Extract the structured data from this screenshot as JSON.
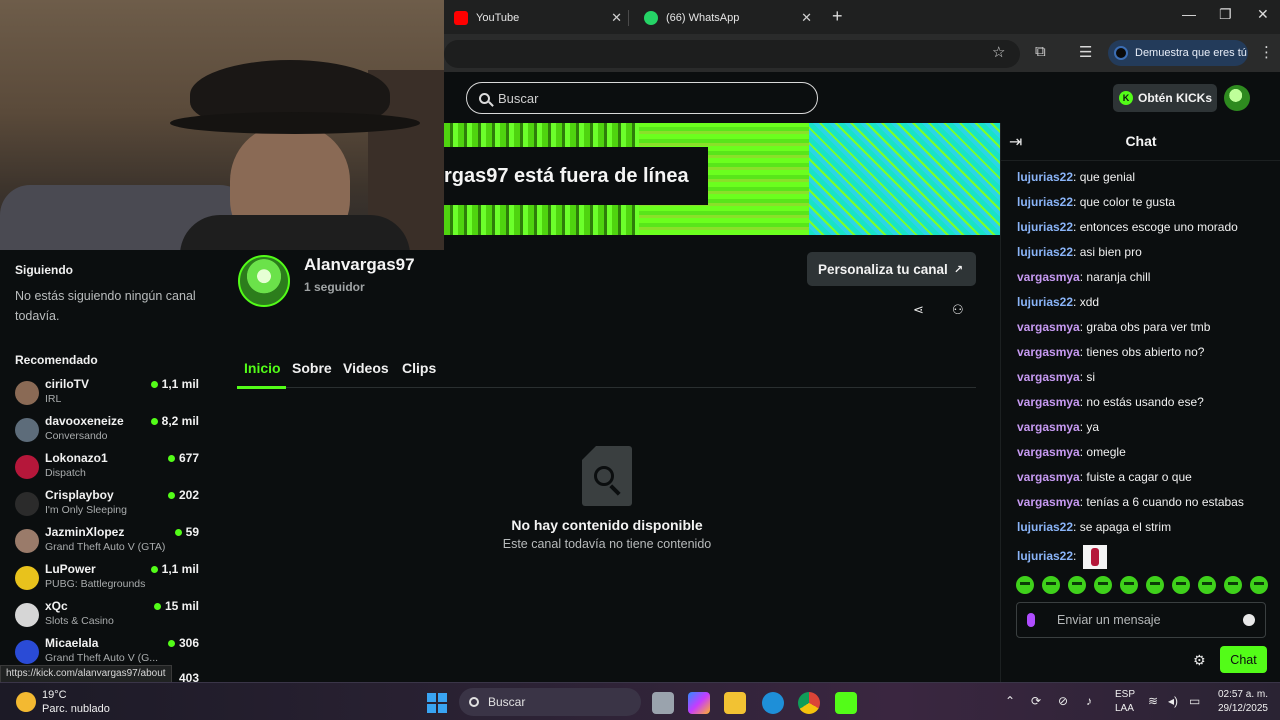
{
  "browser": {
    "tabs": [
      {
        "title": "YouTube",
        "icon": "youtube-icon",
        "color": "#ff0000"
      },
      {
        "title": "(66) WhatsApp",
        "icon": "whatsapp-icon",
        "color": "#25d366"
      }
    ],
    "profile_label": "Demuestra que eres tú"
  },
  "kick": {
    "search_placeholder": "Buscar",
    "kicks_button": "Obtén KICKs",
    "offline_text": "rgas97 está fuera de línea",
    "accent": "#53fc18"
  },
  "sidebar": {
    "following_title": "Siguiendo",
    "following_note": "No estás siguiendo ningún canal todavía.",
    "recommended_title": "Recomendado",
    "recommended": [
      {
        "name": "ciriloTV",
        "category": "IRL",
        "viewers": "1,1 mil",
        "color": "#8a6a55"
      },
      {
        "name": "davooxeneize",
        "category": "Conversando",
        "viewers": "8,2 mil",
        "color": "#5d6c7a"
      },
      {
        "name": "Lokonazo1",
        "category": "Dispatch",
        "viewers": "677",
        "color": "#b5173a"
      },
      {
        "name": "Crisplayboy",
        "category": "I'm Only Sleeping",
        "viewers": "202",
        "color": "#2b2b2b"
      },
      {
        "name": "JazminXlopez",
        "category": "Grand Theft Auto V (GTA)",
        "viewers": "59",
        "color": "#9a7b6a"
      },
      {
        "name": "LuPower",
        "category": "PUBG: Battlegrounds",
        "viewers": "1,1 mil",
        "color": "#e8c21c"
      },
      {
        "name": "xQc",
        "category": "Slots & Casino",
        "viewers": "15 mil",
        "color": "#d6d6d6"
      },
      {
        "name": "Micaelala",
        "category": "Grand Theft Auto V (G...",
        "viewers": "306",
        "color": "#2a4bd6"
      }
    ],
    "cut_off_viewers": "403",
    "status_url": "https://kick.com/alanvargas97/about"
  },
  "channel": {
    "name": "Alanvargas97",
    "followers": "1 seguidor",
    "personalize_label": "Personaliza tu canal",
    "tabs": [
      "Inicio",
      "Sobre",
      "Videos",
      "Clips"
    ],
    "empty_title": "No hay contenido disponible",
    "empty_subtitle": "Este canal todavía no tiene contenido"
  },
  "chat": {
    "title": "Chat",
    "user_colors": {
      "lujurias22": "#8ab4f8",
      "vargasmya": "#c79af2"
    },
    "messages": [
      {
        "user": "lujurias22",
        "text": "que genial"
      },
      {
        "user": "lujurias22",
        "text": "que color te gusta"
      },
      {
        "user": "lujurias22",
        "text": "entonces escoge uno morado"
      },
      {
        "user": "lujurias22",
        "text": "asi bien pro"
      },
      {
        "user": "vargasmya",
        "text": "naranja chill"
      },
      {
        "user": "lujurias22",
        "text": "xdd"
      },
      {
        "user": "vargasmya",
        "text": "graba obs para ver tmb"
      },
      {
        "user": "vargasmya",
        "text": "tienes obs abierto no?"
      },
      {
        "user": "vargasmya",
        "text": "si"
      },
      {
        "user": "vargasmya",
        "text": "no estás usando ese?"
      },
      {
        "user": "vargasmya",
        "text": "ya"
      },
      {
        "user": "vargasmya",
        "text": "omegle"
      },
      {
        "user": "vargasmya",
        "text": "fuiste a cagar o que"
      },
      {
        "user": "vargasmya",
        "text": "tenías a 6 cuando no estabas"
      },
      {
        "user": "lujurias22",
        "text": "se apaga el strim"
      },
      {
        "user": "lujurias22",
        "text": ""
      }
    ],
    "input_placeholder": "Enviar un mensaje",
    "send_label": "Chat"
  },
  "taskbar": {
    "temperature": "19°C",
    "weather": "Parc. nublado",
    "search_label": "Buscar",
    "lang_1": "ESP",
    "lang_2": "LAA",
    "time": "02:57 a. m.",
    "date": "29/12/2025"
  }
}
